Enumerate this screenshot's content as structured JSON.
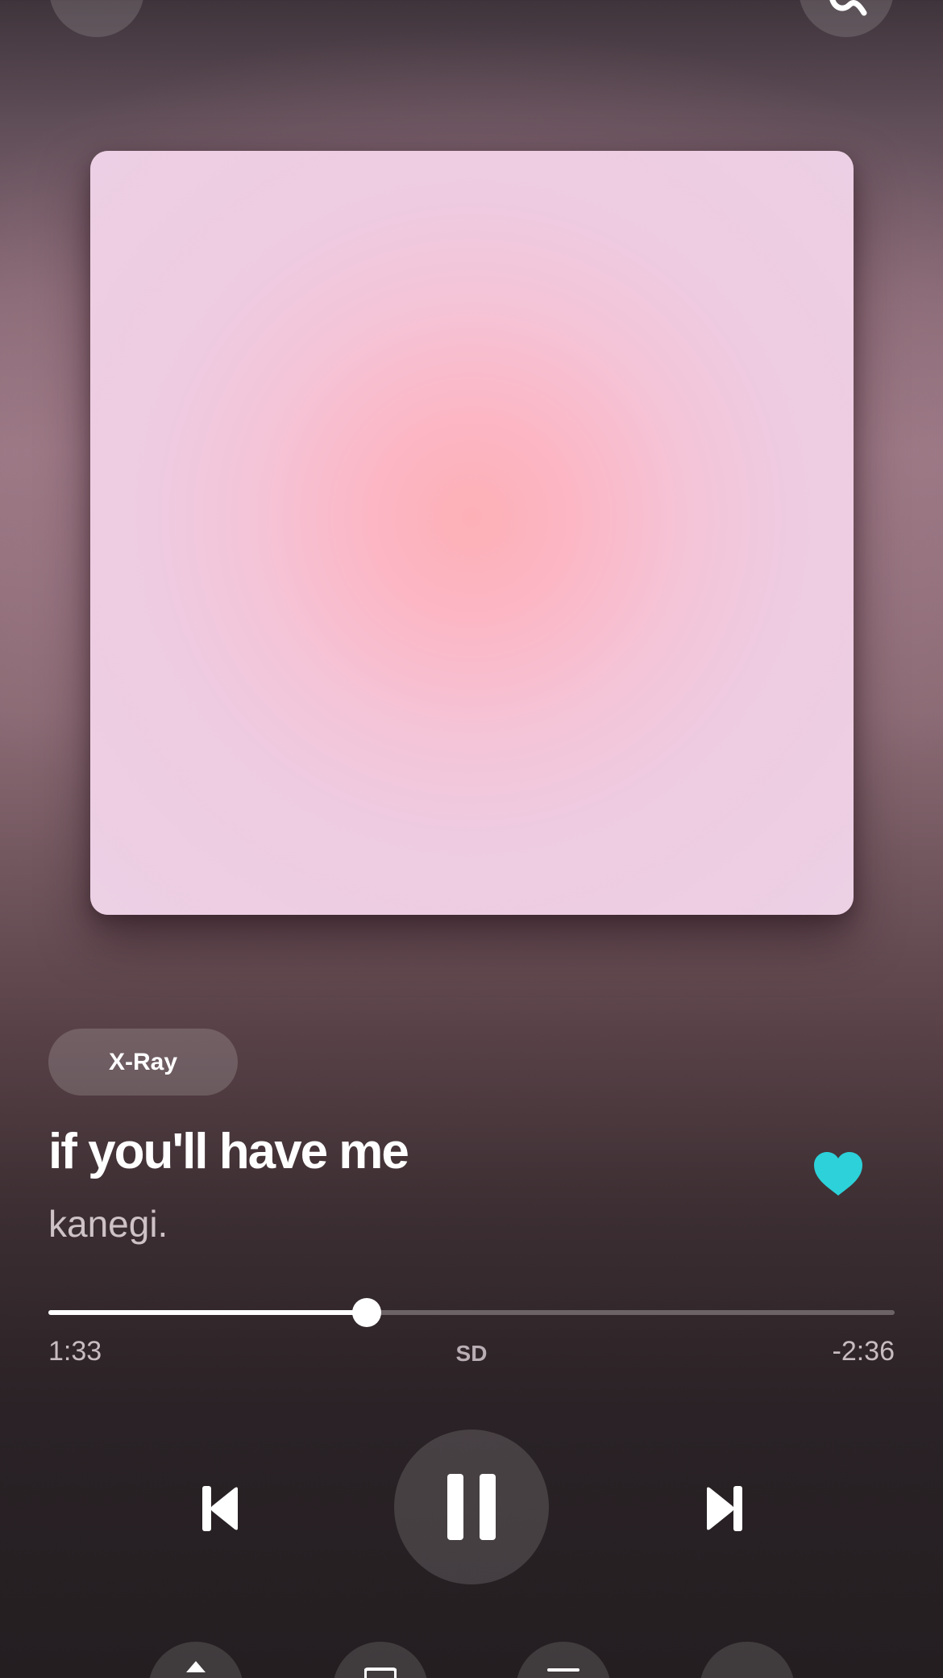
{
  "top_bar": {
    "left_icon": "chevron-down-icon",
    "right_icon": "more-icon"
  },
  "album_art": {
    "colors": [
      "#fdb0b6",
      "#f5c3d6",
      "#ecd0e4"
    ]
  },
  "xray": {
    "label": "X-Ray"
  },
  "track": {
    "title": "if you'll have me",
    "artist": "kanegi.",
    "liked": true
  },
  "playback": {
    "elapsed": "1:33",
    "remaining": "-2:36",
    "quality": "SD",
    "progress": 0.376
  },
  "controls": {
    "previous_icon": "skip-previous-icon",
    "pause_icon": "pause-icon",
    "next_icon": "skip-next-icon"
  },
  "bottom_bar": {
    "icons": [
      "share-icon",
      "lyrics-icon",
      "queue-icon",
      "cast-icon"
    ]
  },
  "colors": {
    "accent": "#2cd1d9",
    "text_primary": "#ffffff",
    "text_secondary": "#cfc2c7"
  }
}
